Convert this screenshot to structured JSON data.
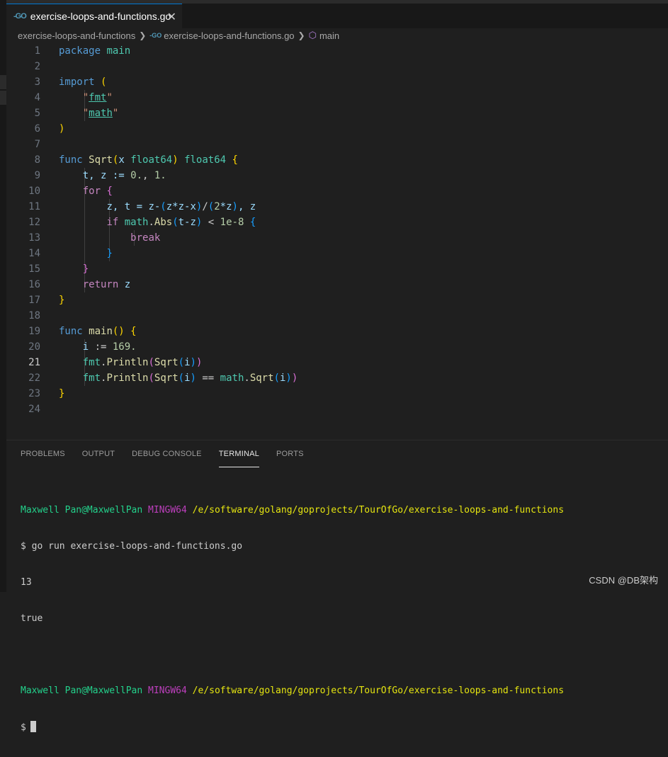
{
  "tab": {
    "icon": "go-file-icon",
    "label": "exercise-loops-and-functions.go",
    "close": "✕"
  },
  "breadcrumb": {
    "folder": "exercise-loops-and-functions",
    "file": "exercise-loops-and-functions.go",
    "symbol": "main"
  },
  "editor": {
    "active_line": 21,
    "lines": [
      {
        "n": "1"
      },
      {
        "n": "2"
      },
      {
        "n": "3"
      },
      {
        "n": "4"
      },
      {
        "n": "5"
      },
      {
        "n": "6"
      },
      {
        "n": "7"
      },
      {
        "n": "8"
      },
      {
        "n": "9"
      },
      {
        "n": "10"
      },
      {
        "n": "11"
      },
      {
        "n": "12"
      },
      {
        "n": "13"
      },
      {
        "n": "14"
      },
      {
        "n": "15"
      },
      {
        "n": "16"
      },
      {
        "n": "17"
      },
      {
        "n": "18"
      },
      {
        "n": "19"
      },
      {
        "n": "20"
      },
      {
        "n": "21"
      },
      {
        "n": "22"
      },
      {
        "n": "23"
      },
      {
        "n": "24"
      }
    ],
    "code": {
      "l1_package": "package",
      "l1_name": "main",
      "l3_import": "import",
      "l4_fmt": "fmt",
      "l5_math": "math",
      "l8_func": "func",
      "l8_name": "Sqrt",
      "l8_param": "x",
      "l8_type": "float64",
      "l8_ret": "float64",
      "l9": "t, z := ",
      "l9_a": "0.",
      "l9_b": "1.",
      "l10_for": "for",
      "l11_a": "z, t = z-",
      "l11_b": "z*z-x",
      "l11_c": "2",
      "l11_d": "*z",
      "l11_e": ", z",
      "l12_if": "if",
      "l12_pkg": "math",
      "l12_fn": "Abs",
      "l12_arg": "t-z",
      "l12_lt": " < ",
      "l12_num": "1e-8",
      "l13_break": "break",
      "l16_return": "return",
      "l16_z": "z",
      "l19_func": "func",
      "l19_name": "main",
      "l20_i": "i",
      "l20_op": " := ",
      "l20_num": "169.",
      "l21_pkg": "fmt",
      "l21_fn": "Println",
      "l21_call": "Sqrt",
      "l21_arg": "i",
      "l22_pkg": "fmt",
      "l22_fn": "Println",
      "l22_call": "Sqrt",
      "l22_arg": "i",
      "l22_eq": " == ",
      "l22_pkg2": "math",
      "l22_call2": "Sqrt",
      "l22_arg2": "i"
    }
  },
  "panel": {
    "tabs": [
      "PROBLEMS",
      "OUTPUT",
      "DEBUG CONSOLE",
      "TERMINAL",
      "PORTS"
    ],
    "active_tab": "TERMINAL"
  },
  "terminal": {
    "user": "Maxwell Pan@MaxwellPan",
    "shell": "MINGW64",
    "path": "/e/software/golang/goprojects/TourOfGo/exercise-loops-and-functions",
    "command": "$ go run exercise-loops-and-functions.go",
    "output1": "13",
    "output2": "true",
    "prompt": "$"
  },
  "watermark": "CSDN @DB架构",
  "colors": {
    "background": "#1f1f1f",
    "accent": "#0078d4",
    "terminal_green": "#23d18b",
    "terminal_magenta": "#bc3fbc",
    "terminal_yellow": "#e5e510"
  }
}
